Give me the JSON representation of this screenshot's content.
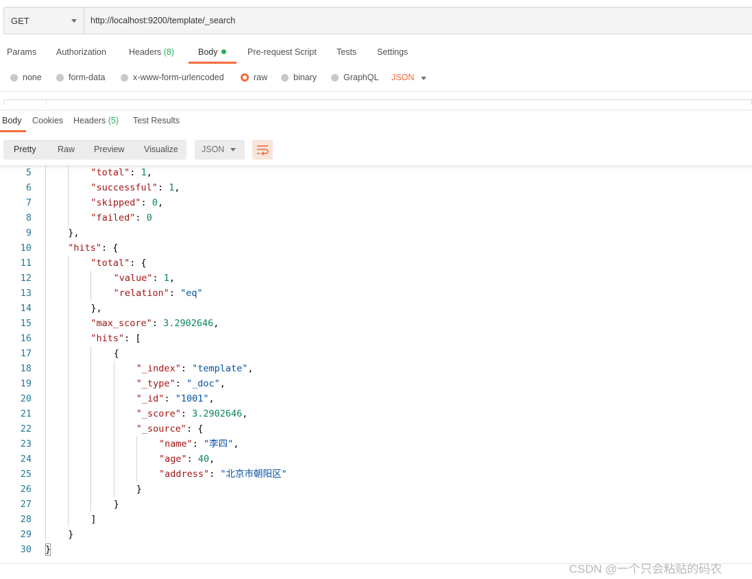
{
  "request": {
    "method": "GET",
    "url": "http://localhost:9200/template/_search"
  },
  "request_tabs": {
    "params": "Params",
    "authorization": "Authorization",
    "headers": "Headers",
    "headers_count": "(8)",
    "body": "Body",
    "prerequest": "Pre-request Script",
    "tests": "Tests",
    "settings": "Settings"
  },
  "body_modes": {
    "none": "none",
    "form_data": "form-data",
    "urlencoded": "x-www-form-urlencoded",
    "raw": "raw",
    "binary": "binary",
    "graphql": "GraphQL",
    "selected_language": "JSON"
  },
  "response_tabs": {
    "body": "Body",
    "cookies": "Cookies",
    "headers": "Headers",
    "headers_count": "(5)",
    "test_results": "Test Results"
  },
  "response_toolbar": {
    "pretty": "Pretty",
    "raw": "Raw",
    "preview": "Preview",
    "visualize": "Visualize",
    "format": "JSON"
  },
  "code_lines": [
    {
      "n": "5",
      "indent": 2,
      "t": [
        [
          "k",
          "\"total\""
        ],
        [
          "p",
          ": "
        ],
        [
          "n",
          "1"
        ],
        [
          "p",
          ","
        ]
      ]
    },
    {
      "n": "6",
      "indent": 2,
      "t": [
        [
          "k",
          "\"successful\""
        ],
        [
          "p",
          ": "
        ],
        [
          "n",
          "1"
        ],
        [
          "p",
          ","
        ]
      ]
    },
    {
      "n": "7",
      "indent": 2,
      "t": [
        [
          "k",
          "\"skipped\""
        ],
        [
          "p",
          ": "
        ],
        [
          "n",
          "0"
        ],
        [
          "p",
          ","
        ]
      ]
    },
    {
      "n": "8",
      "indent": 2,
      "t": [
        [
          "k",
          "\"failed\""
        ],
        [
          "p",
          ": "
        ],
        [
          "n",
          "0"
        ]
      ]
    },
    {
      "n": "9",
      "indent": 1,
      "t": [
        [
          "p",
          "},"
        ]
      ]
    },
    {
      "n": "10",
      "indent": 1,
      "t": [
        [
          "k",
          "\"hits\""
        ],
        [
          "p",
          ": {"
        ]
      ]
    },
    {
      "n": "11",
      "indent": 2,
      "t": [
        [
          "k",
          "\"total\""
        ],
        [
          "p",
          ": {"
        ]
      ]
    },
    {
      "n": "12",
      "indent": 3,
      "t": [
        [
          "k",
          "\"value\""
        ],
        [
          "p",
          ": "
        ],
        [
          "n",
          "1"
        ],
        [
          "p",
          ","
        ]
      ]
    },
    {
      "n": "13",
      "indent": 3,
      "t": [
        [
          "k",
          "\"relation\""
        ],
        [
          "p",
          ": "
        ],
        [
          "s",
          "\"eq\""
        ]
      ]
    },
    {
      "n": "14",
      "indent": 2,
      "t": [
        [
          "p",
          "},"
        ]
      ]
    },
    {
      "n": "15",
      "indent": 2,
      "t": [
        [
          "k",
          "\"max_score\""
        ],
        [
          "p",
          ": "
        ],
        [
          "n",
          "3.2902646"
        ],
        [
          "p",
          ","
        ]
      ]
    },
    {
      "n": "16",
      "indent": 2,
      "t": [
        [
          "k",
          "\"hits\""
        ],
        [
          "p",
          ": ["
        ]
      ]
    },
    {
      "n": "17",
      "indent": 3,
      "t": [
        [
          "p",
          "{"
        ]
      ]
    },
    {
      "n": "18",
      "indent": 4,
      "t": [
        [
          "k",
          "\"_index\""
        ],
        [
          "p",
          ": "
        ],
        [
          "s",
          "\"template\""
        ],
        [
          "p",
          ","
        ]
      ]
    },
    {
      "n": "19",
      "indent": 4,
      "t": [
        [
          "k",
          "\"_type\""
        ],
        [
          "p",
          ": "
        ],
        [
          "s",
          "\"_doc\""
        ],
        [
          "p",
          ","
        ]
      ]
    },
    {
      "n": "20",
      "indent": 4,
      "t": [
        [
          "k",
          "\"_id\""
        ],
        [
          "p",
          ": "
        ],
        [
          "s",
          "\"1001\""
        ],
        [
          "p",
          ","
        ]
      ]
    },
    {
      "n": "21",
      "indent": 4,
      "t": [
        [
          "k",
          "\"_score\""
        ],
        [
          "p",
          ": "
        ],
        [
          "n",
          "3.2902646"
        ],
        [
          "p",
          ","
        ]
      ]
    },
    {
      "n": "22",
      "indent": 4,
      "t": [
        [
          "k",
          "\"_source\""
        ],
        [
          "p",
          ": {"
        ]
      ]
    },
    {
      "n": "23",
      "indent": 5,
      "t": [
        [
          "k",
          "\"name\""
        ],
        [
          "p",
          ": "
        ],
        [
          "s",
          "\"李四\""
        ],
        [
          "p",
          ","
        ]
      ]
    },
    {
      "n": "24",
      "indent": 5,
      "t": [
        [
          "k",
          "\"age\""
        ],
        [
          "p",
          ": "
        ],
        [
          "n",
          "40"
        ],
        [
          "p",
          ","
        ]
      ]
    },
    {
      "n": "25",
      "indent": 5,
      "t": [
        [
          "k",
          "\"address\""
        ],
        [
          "p",
          ": "
        ],
        [
          "s",
          "\"北京市朝阳区\""
        ]
      ]
    },
    {
      "n": "26",
      "indent": 4,
      "t": [
        [
          "p",
          "}"
        ]
      ]
    },
    {
      "n": "27",
      "indent": 3,
      "t": [
        [
          "p",
          "}"
        ]
      ]
    },
    {
      "n": "28",
      "indent": 2,
      "t": [
        [
          "p",
          "]"
        ]
      ]
    },
    {
      "n": "29",
      "indent": 1,
      "t": [
        [
          "p",
          "}"
        ]
      ]
    },
    {
      "n": "30",
      "indent": 0,
      "t": [
        [
          "p",
          "}"
        ]
      ]
    }
  ],
  "watermark": "CSDN @一个只会粘贴的码农",
  "colors": {
    "accent": "#f26b3a",
    "count_green": "#27ae60",
    "json_key": "#a31515",
    "json_string": "#0451a5",
    "json_number": "#098658",
    "line_number": "#237893"
  }
}
